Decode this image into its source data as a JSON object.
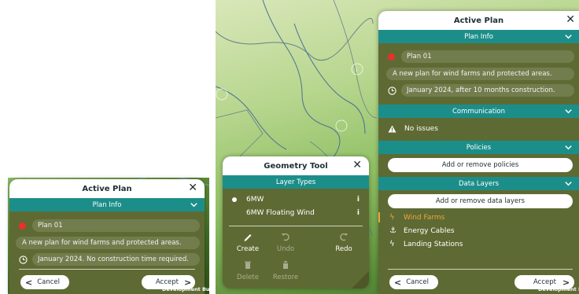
{
  "small_panel": {
    "title": "Active Plan",
    "plan_info_label": "Plan Info",
    "plan_name": "Plan 01",
    "description": "A new plan for wind farms and protected areas.",
    "timeline": "January 2024. No construction time required.",
    "cancel_label": "Cancel",
    "accept_label": "Accept",
    "plan_color": "#e8312a"
  },
  "geometry_tool": {
    "title": "Geometry Tool",
    "layer_types_label": "Layer Types",
    "layer_types": [
      {
        "label": "6MW",
        "selected": true
      },
      {
        "label": "6MW Floating Wind",
        "selected": false
      }
    ],
    "tools": [
      {
        "label": "Create",
        "icon": "pencil-icon",
        "enabled": true
      },
      {
        "label": "Undo",
        "icon": "undo-icon",
        "enabled": false
      },
      {
        "label": "Redo",
        "icon": "redo-icon",
        "enabled": true
      },
      {
        "label": "Delete",
        "icon": "trash-icon",
        "enabled": false
      },
      {
        "label": "Restore",
        "icon": "restore-icon",
        "enabled": false
      }
    ]
  },
  "active_plan": {
    "title": "Active Plan",
    "plan_info_label": "Plan Info",
    "plan_name": "Plan 01",
    "description": "A new plan for wind farms and protected areas.",
    "timeline": "January 2024, after 10 months construction.",
    "communication_label": "Communication",
    "communication_status": "No issues",
    "policies_label": "Policies",
    "policies_button": "Add or remove policies",
    "data_layers_label": "Data Layers",
    "data_layers_button": "Add or remove data layers",
    "layers": [
      {
        "label": "Wind Farms",
        "icon": "wind-icon",
        "active": true
      },
      {
        "label": "Energy Cables",
        "icon": "cable-icon",
        "active": false
      },
      {
        "label": "Landing Stations",
        "icon": "station-icon",
        "active": false
      }
    ],
    "cancel_label": "Cancel",
    "accept_label": "Accept"
  },
  "watermark": {
    "left": "Development Buil",
    "right": "Development B"
  },
  "colors": {
    "teal": "#1c8e8a",
    "panel_bg": "#5e6a33",
    "active_layer": "#f0a33a"
  }
}
